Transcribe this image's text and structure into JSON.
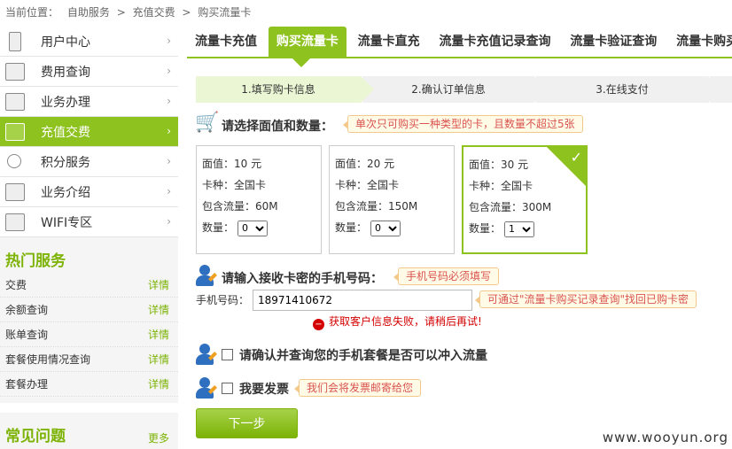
{
  "breadcrumb": {
    "label": "当前位置：",
    "items": [
      "自助服务",
      ">",
      "充值交费",
      ">",
      "购买流量卡"
    ]
  },
  "sidebar": {
    "items": [
      {
        "label": "用户中心",
        "icon": "phone-icon"
      },
      {
        "label": "费用查询",
        "icon": "grid-icon"
      },
      {
        "label": "业务办理",
        "icon": "window-e-icon"
      },
      {
        "label": "充值交费",
        "icon": "keyboard-icon",
        "active": true
      },
      {
        "label": "积分服务",
        "icon": "search-icon"
      },
      {
        "label": "业务介绍",
        "icon": "briefcase-icon"
      },
      {
        "label": "WIFI专区",
        "icon": "window-e-icon"
      }
    ],
    "arrow": "›"
  },
  "hot": {
    "title": "热门服务",
    "more_label": "详情",
    "items": [
      "交费",
      "余额查询",
      "账单查询",
      "套餐使用情况查询",
      "套餐办理"
    ]
  },
  "faq": {
    "title": "常见问题",
    "more_label": "更多"
  },
  "tabs": [
    "流量卡充值",
    "购买流量卡",
    "流量卡直充",
    "流量卡充值记录查询",
    "流量卡验证查询",
    "流量卡购买"
  ],
  "steps": [
    "1.填写购卡信息",
    "2.确认订单信息",
    "3.在线支付"
  ],
  "section1": {
    "title": "请选择面值和数量：",
    "tip": "单次只可购买一种类型的卡，且数量不超过5张"
  },
  "cards": [
    {
      "face_label": "面值：",
      "face": "10 元",
      "type_label": "卡种：",
      "type": "全国卡",
      "flow_label": "包含流量：",
      "flow": "60M",
      "qty_label": "数量：",
      "qty": "0",
      "selected": false
    },
    {
      "face_label": "面值：",
      "face": "20 元",
      "type_label": "卡种：",
      "type": "全国卡",
      "flow_label": "包含流量：",
      "flow": "150M",
      "qty_label": "数量：",
      "qty": "0",
      "selected": false
    },
    {
      "face_label": "面值：",
      "face": "30 元",
      "type_label": "卡种：",
      "type": "全国卡",
      "flow_label": "包含流量：",
      "flow": "300M",
      "qty_label": "数量：",
      "qty": "1",
      "selected": true
    }
  ],
  "section2": {
    "title": "请输入接收卡密的手机号码：",
    "tip": "手机号码必须填写",
    "phone_label": "手机号码：",
    "phone_value": "18971410672",
    "phone_tip": "可通过\"流量卡购买记录查询\"找回已购卡密",
    "error": "获取客户信息失败，请稍后再试!",
    "error_icon": "−"
  },
  "section3": {
    "confirm_label": "请确认并查询您的手机套餐是否可以冲入流量"
  },
  "section4": {
    "invoice_label": "我要发票",
    "invoice_tip": "我们会将发票邮寄给您"
  },
  "next_button": "下一步",
  "watermark": "www.wooyun.org",
  "colors": {
    "accent": "#8dc21f",
    "error": "#d40000"
  }
}
